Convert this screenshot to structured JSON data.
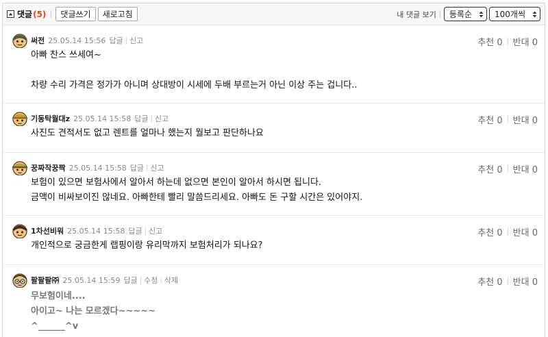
{
  "toolbar": {
    "comment_label": "댓글",
    "comment_count": "(5)",
    "write_button": "댓글쓰기",
    "refresh_button": "새로고침",
    "my_comments_link": "내 댓글 보기",
    "sort_select": "등록순",
    "count_select": "100개씩"
  },
  "comments": [
    {
      "nick": "써전",
      "date": "25.05.14 15:56",
      "actions": [
        "답글",
        "신고"
      ],
      "recommend": "추천 0",
      "oppose": "반대 0",
      "lines": [
        "아빠 찬스 쓰세여~",
        "",
        "차량 수리 가격은 정가가 아니며 상대방이 시세에 두배 부르는거 아닌 이상 주는 겁니다.."
      ]
    },
    {
      "nick": "기동탁월대z",
      "date": "25.05.14 15:58",
      "actions": [
        "답글",
        "신고"
      ],
      "recommend": "추천 0",
      "oppose": "반대 0",
      "lines": [
        "사진도 견적서도 없고 렌트를 얼마나 했는지 뭘보고 판단하나요"
      ]
    },
    {
      "nick": "꿍짜작꿍짝",
      "date": "25.05.14 15:58",
      "actions": [
        "답글",
        "신고"
      ],
      "recommend": "추천 0",
      "oppose": "반대 0",
      "lines": [
        "보험이 있으면 보험사에서 알아서 하는데 없으면 본인이 알아서 하시면 됩니다.",
        "금액이 비싸보이진 않네요. 아빠한테 빨리 말씀드리세요. 아빠도 돈 구할 시간은 있어야지."
      ]
    },
    {
      "nick": "1차선비워",
      "date": "25.05.14 15:58",
      "actions": [
        "답글",
        "신고"
      ],
      "recommend": "추천 0",
      "oppose": "반대 0",
      "lines": [
        "개인적으로 궁금한게 랩핑이랑 유리막까지 보험처리가 되나요?"
      ]
    },
    {
      "nick": "팔팔팔㈜",
      "date": "25.05.14 15:59",
      "actions": [
        "답글",
        "수정",
        "삭제"
      ],
      "recommend": "추천 0",
      "oppose": "반대 0",
      "lines": [
        "무보험이네....",
        "아이고~ 나는 모르겠다~~~~~",
        "^______^v"
      ]
    }
  ],
  "colors": {
    "count": "#e8461b",
    "text": "#111111",
    "meta": "#888888"
  }
}
